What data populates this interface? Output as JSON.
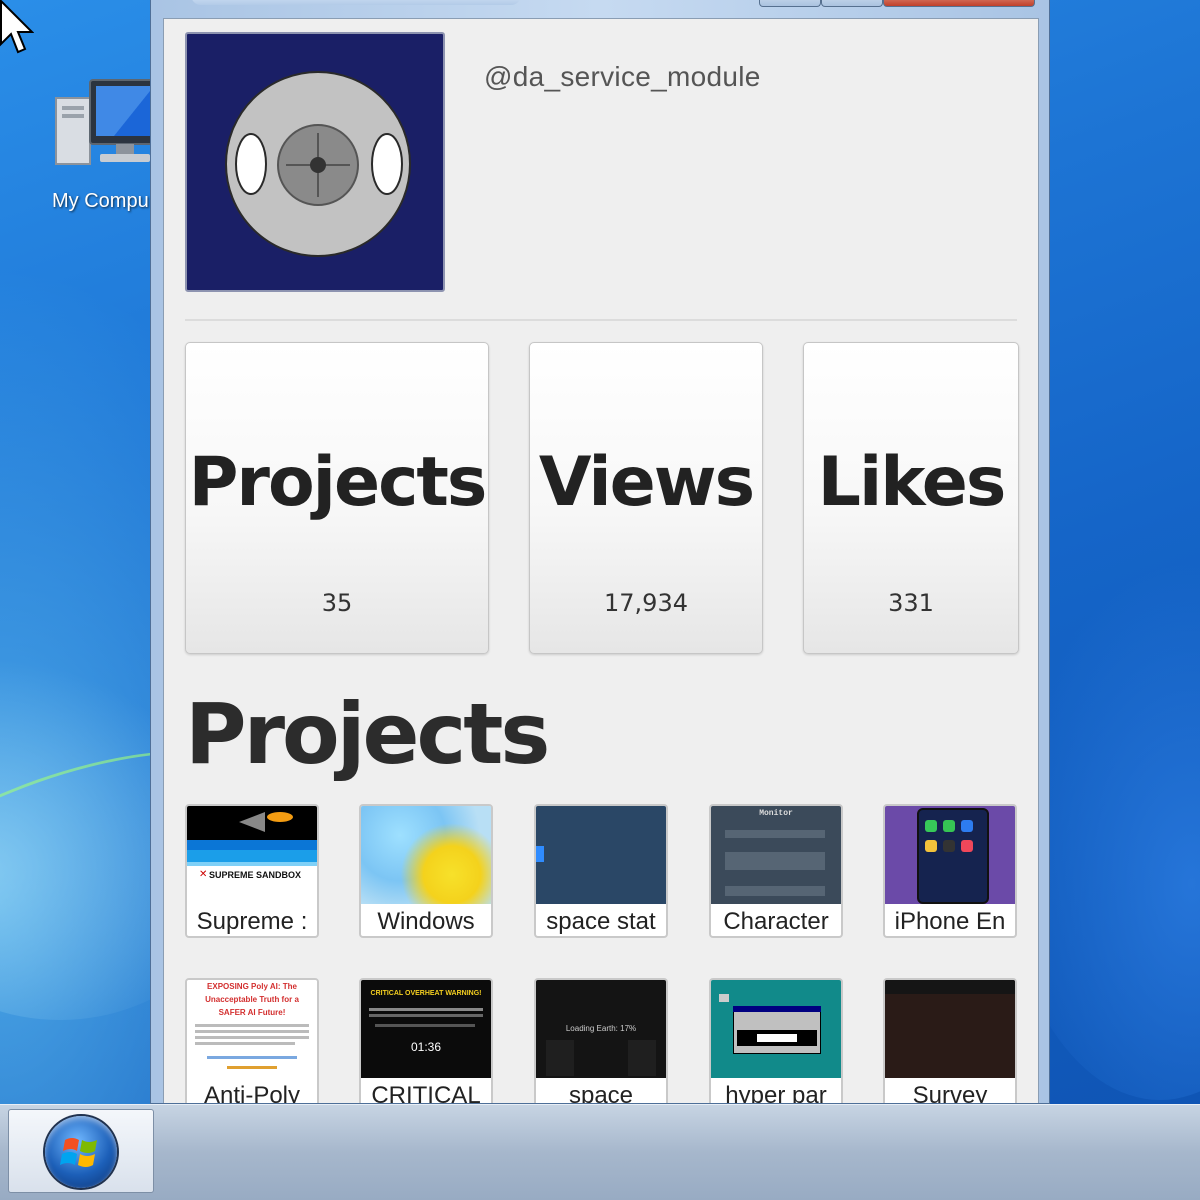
{
  "desktop": {
    "icons": [
      {
        "label": "My Compu",
        "icon": "computer-icon"
      }
    ]
  },
  "profile": {
    "handle": "@da_service_module",
    "avatar_icon": "robot-face-avatar"
  },
  "stats": {
    "projects": {
      "title": "Projects",
      "value": "35"
    },
    "views": {
      "title": "Views",
      "value": "17,934"
    },
    "likes": {
      "title": "Likes",
      "value": "331"
    }
  },
  "projects_section": {
    "title": "Projects",
    "items": [
      {
        "name": "Supreme :",
        "thumb_text": "SUPREME SANDBOX"
      },
      {
        "name": "Windows",
        "thumb_text": ""
      },
      {
        "name": "space stat",
        "thumb_text": ""
      },
      {
        "name": "Character",
        "thumb_text": "Monitor"
      },
      {
        "name": "iPhone En",
        "thumb_text": ""
      },
      {
        "name": "Anti-Poly",
        "thumb_text": "EXPOSING Poly AI: The Unacceptable Truth for a SAFER AI Future!"
      },
      {
        "name": "CRITICAL",
        "thumb_text": "CRITICAL OVERHEAT WARNING!",
        "thumb_timer": "01:36"
      },
      {
        "name": "space",
        "thumb_text": "Loading Earth: 17%"
      },
      {
        "name": "hyper par",
        "thumb_text": ""
      },
      {
        "name": "Survey",
        "thumb_text": ""
      }
    ]
  },
  "taskbar": {
    "start_icon": "windows-start-orb-icon"
  },
  "colors": {
    "avatar_bg": "#1a1f66",
    "content_bg": "#efefef",
    "desktop_blue": "#1d74d4"
  }
}
